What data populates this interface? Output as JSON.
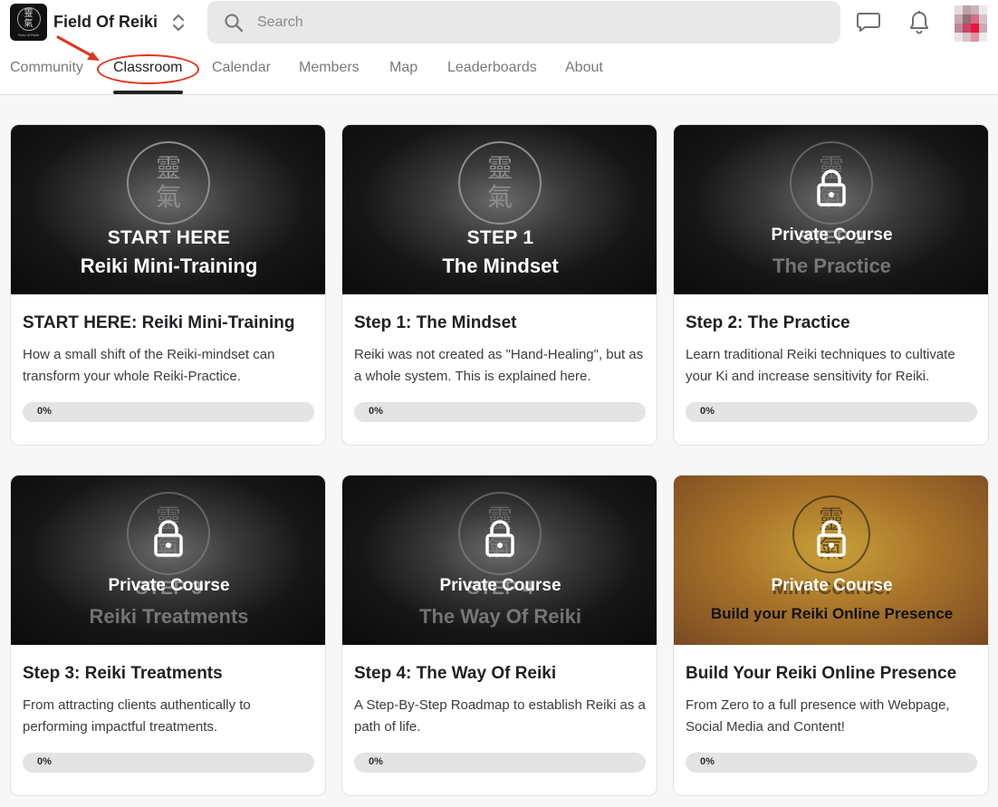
{
  "header": {
    "community_name": "Field Of Reiki",
    "logo_text": "Field of Reiki",
    "search_placeholder": "Search"
  },
  "tabs": [
    {
      "label": "Community",
      "active": false
    },
    {
      "label": "Classroom",
      "active": true
    },
    {
      "label": "Calendar",
      "active": false
    },
    {
      "label": "Members",
      "active": false
    },
    {
      "label": "Map",
      "active": false
    },
    {
      "label": "Leaderboards",
      "active": false
    },
    {
      "label": "About",
      "active": false
    }
  ],
  "seal_glyphs": [
    "靈",
    "氣"
  ],
  "courses": [
    {
      "thumb_line1": "START HERE",
      "thumb_line2": "Reiki Mini-Training",
      "private": false,
      "private_label": "",
      "title": "START HERE: Reiki Mini-Training",
      "description": "How a small shift of the Reiki-mindset can transform your whole Reiki-Practice.",
      "progress": 0,
      "progress_text": "0%"
    },
    {
      "thumb_line1": "STEP 1",
      "thumb_line2": "The Mindset",
      "private": false,
      "private_label": "",
      "title": "Step 1: The Mindset",
      "description": "Reiki was not created as \"Hand-Healing\", but as a whole system. This is explained here.",
      "progress": 0,
      "progress_text": "0%"
    },
    {
      "thumb_line1": "STEP 2",
      "thumb_line2": "The Practice",
      "private": true,
      "private_label": "Private Course",
      "title": "Step 2: The Practice",
      "description": "Learn traditional Reiki techniques to cultivate your Ki and increase sensitivity for Reiki.",
      "progress": 0,
      "progress_text": "0%"
    },
    {
      "thumb_line1": "STEP 3",
      "thumb_line2": "Reiki Treatments",
      "private": true,
      "private_label": "Private Course",
      "title": "Step 3: Reiki Treatments",
      "description": "From attracting clients authentically to performing impactful treatments.",
      "progress": 0,
      "progress_text": "0%"
    },
    {
      "thumb_line1": "STEP 4",
      "thumb_line2": "The Way Of Reiki",
      "private": true,
      "private_label": "Private Course",
      "title": "Step 4: The Way Of Reiki",
      "description": "A Step-By-Step Roadmap to establish Reiki as a path of life.",
      "progress": 0,
      "progress_text": "0%"
    },
    {
      "thumb_line1": "Mini-Course:",
      "thumb_line2": "Build your Reiki Online Presence",
      "private": true,
      "private_label": "Private Course",
      "title": "Build Your Reiki Online Presence",
      "description": "From Zero to a full presence with Webpage, Social Media and Content!",
      "progress": 0,
      "progress_text": "0%"
    }
  ],
  "colors": {
    "annotation_red": "#e0341c",
    "progress_track": "#e4e4e4",
    "active_tab": "#202124"
  }
}
